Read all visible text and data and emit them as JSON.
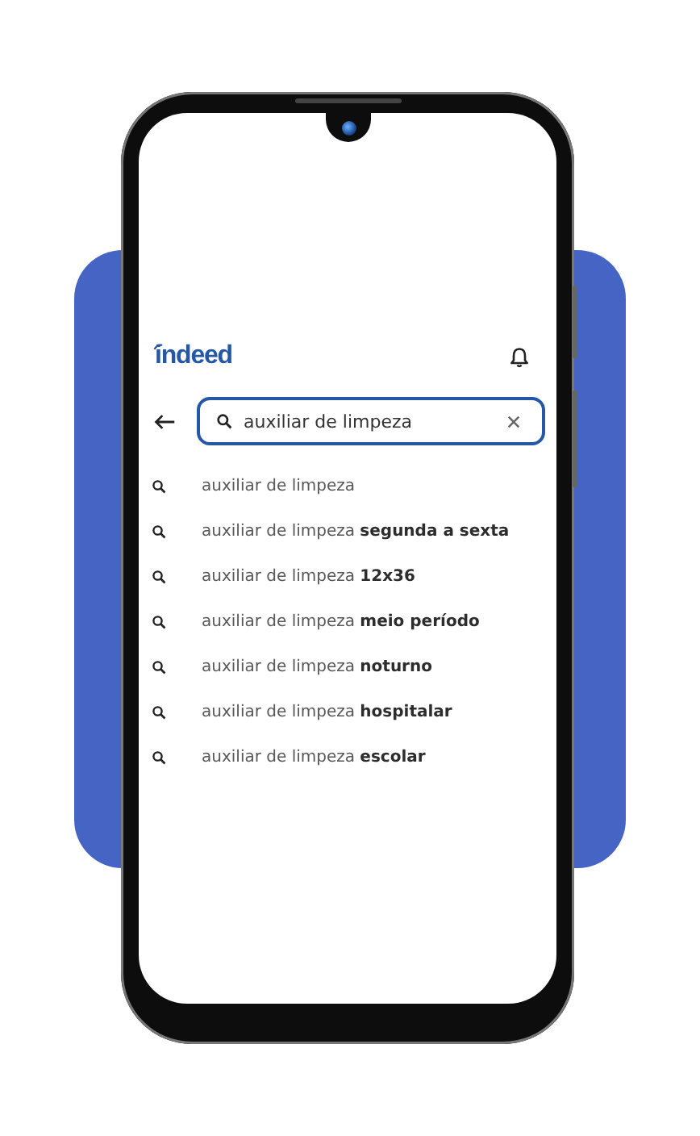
{
  "app_bar": {
    "logo": "indeed"
  },
  "search": {
    "value": "auxiliar de limpeza"
  },
  "suggestions": [
    {
      "text": "auxiliar de limpeza"
    },
    {
      "text": "auxiliar de limpeza **segunda a sexta**"
    },
    {
      "text": "auxiliar de limpeza **12x36**"
    },
    {
      "text": "auxiliar de limpeza **meio período**"
    },
    {
      "text": "auxiliar de limpeza **noturno**"
    },
    {
      "text": "auxiliar de limpeza **hospitalar**"
    },
    {
      "text": "auxiliar de limpeza **escolar**"
    }
  ]
}
